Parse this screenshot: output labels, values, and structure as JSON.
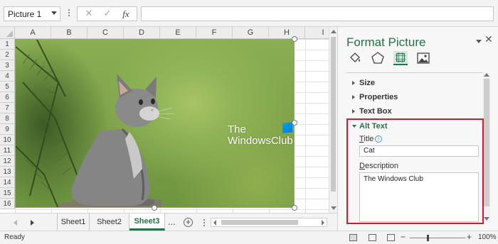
{
  "formula_bar": {
    "name_box": "Picture 1",
    "cancel_glyph": "✕",
    "enter_glyph": "✓",
    "fx_label": "fx",
    "formula_value": ""
  },
  "grid": {
    "columns": [
      "A",
      "B",
      "C",
      "D",
      "E",
      "F",
      "G",
      "H",
      "I"
    ],
    "rows": [
      "1",
      "2",
      "3",
      "4",
      "5",
      "6",
      "7",
      "8",
      "9",
      "10",
      "11",
      "12",
      "13",
      "14",
      "15",
      "16"
    ]
  },
  "picture": {
    "watermark_line1": "The",
    "watermark_line2": "WindowsClub"
  },
  "sheets": {
    "tabs": [
      "Sheet1",
      "Sheet2",
      "Sheet3"
    ],
    "active": "Sheet3",
    "more": "...",
    "add_label": "+"
  },
  "pane": {
    "title": "Format Picture",
    "close_glyph": "✕",
    "icons": [
      "fill-line-icon",
      "effects-icon",
      "size-properties-icon",
      "picture-icon"
    ],
    "sections": [
      "Size",
      "Properties",
      "Text Box"
    ],
    "alt_text": {
      "header": "Alt Text",
      "title_label": "Title",
      "title_value": "Cat",
      "description_label": "Description",
      "description_value": "The Windows Club"
    }
  },
  "status": {
    "ready": "Ready",
    "zoom_minus": "−",
    "zoom_plus": "+",
    "zoom": "100%"
  },
  "colors": {
    "accent": "#217346",
    "highlight_box": "#e81123"
  }
}
